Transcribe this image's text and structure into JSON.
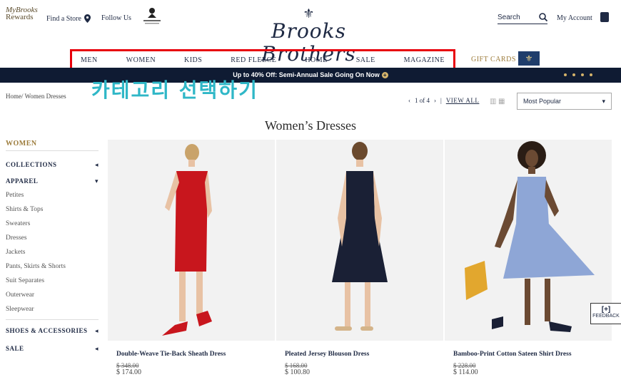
{
  "header": {
    "rewards_my": "My",
    "rewards_brooks": "Brooks",
    "rewards_label": "Rewards",
    "find_store": "Find a Store",
    "follow_us": "Follow Us",
    "logo_text": "Brooks Brothers",
    "search_placeholder": "Search",
    "my_account": "My Account"
  },
  "nav": {
    "items": [
      "MEN",
      "WOMEN",
      "KIDS",
      "RED FLEECE",
      "HOME",
      "SALE",
      "MAGAZINE"
    ],
    "gift_cards": "GIFT CARDS"
  },
  "promo": {
    "text": "Up to 40% Off: Semi-Annual Sale Going On Now"
  },
  "overlay": {
    "text": "카테고리 선택하기"
  },
  "breadcrumb": {
    "home": "Home",
    "current": "Women Dresses"
  },
  "pager": {
    "text": "1 of 4",
    "view_all": "VIEW ALL"
  },
  "sort": {
    "selected": "Most Popular"
  },
  "page_title": "Women’s Dresses",
  "sidebar": {
    "heading": "WOMEN",
    "collections": "COLLECTIONS",
    "apparel": "APPAREL",
    "apparel_items": [
      "Petites",
      "Shirts & Tops",
      "Sweaters",
      "Dresses",
      "Jackets",
      "Pants, Skirts & Shorts",
      "Suit Separates",
      "Outerwear",
      "Sleepwear"
    ],
    "shoes": "SHOES & ACCESSORIES",
    "sale": "SALE"
  },
  "products": [
    {
      "name": "Double-Weave Tie-Back Sheath Dress",
      "orig": "$ 348.00",
      "price": "$ 174.00",
      "dress_color": "#c8161d"
    },
    {
      "name": "Pleated Jersey Blouson Dress",
      "orig": "$ 168.00",
      "price": "$ 100.80",
      "dress_color": "#1a2035"
    },
    {
      "name": "Bamboo-Print Cotton Sateen Shirt Dress",
      "orig": "$ 228.00",
      "price": "$ 114.00",
      "dress_color": "#8ea6d6"
    }
  ],
  "feedback": {
    "plus": "[+]",
    "label": "FEEDBACK"
  },
  "colors": {
    "navy": "#0f1b33",
    "gold": "#9c7b3a",
    "highlight_red": "#e8000b",
    "overlay_teal": "#2fb7c7"
  }
}
